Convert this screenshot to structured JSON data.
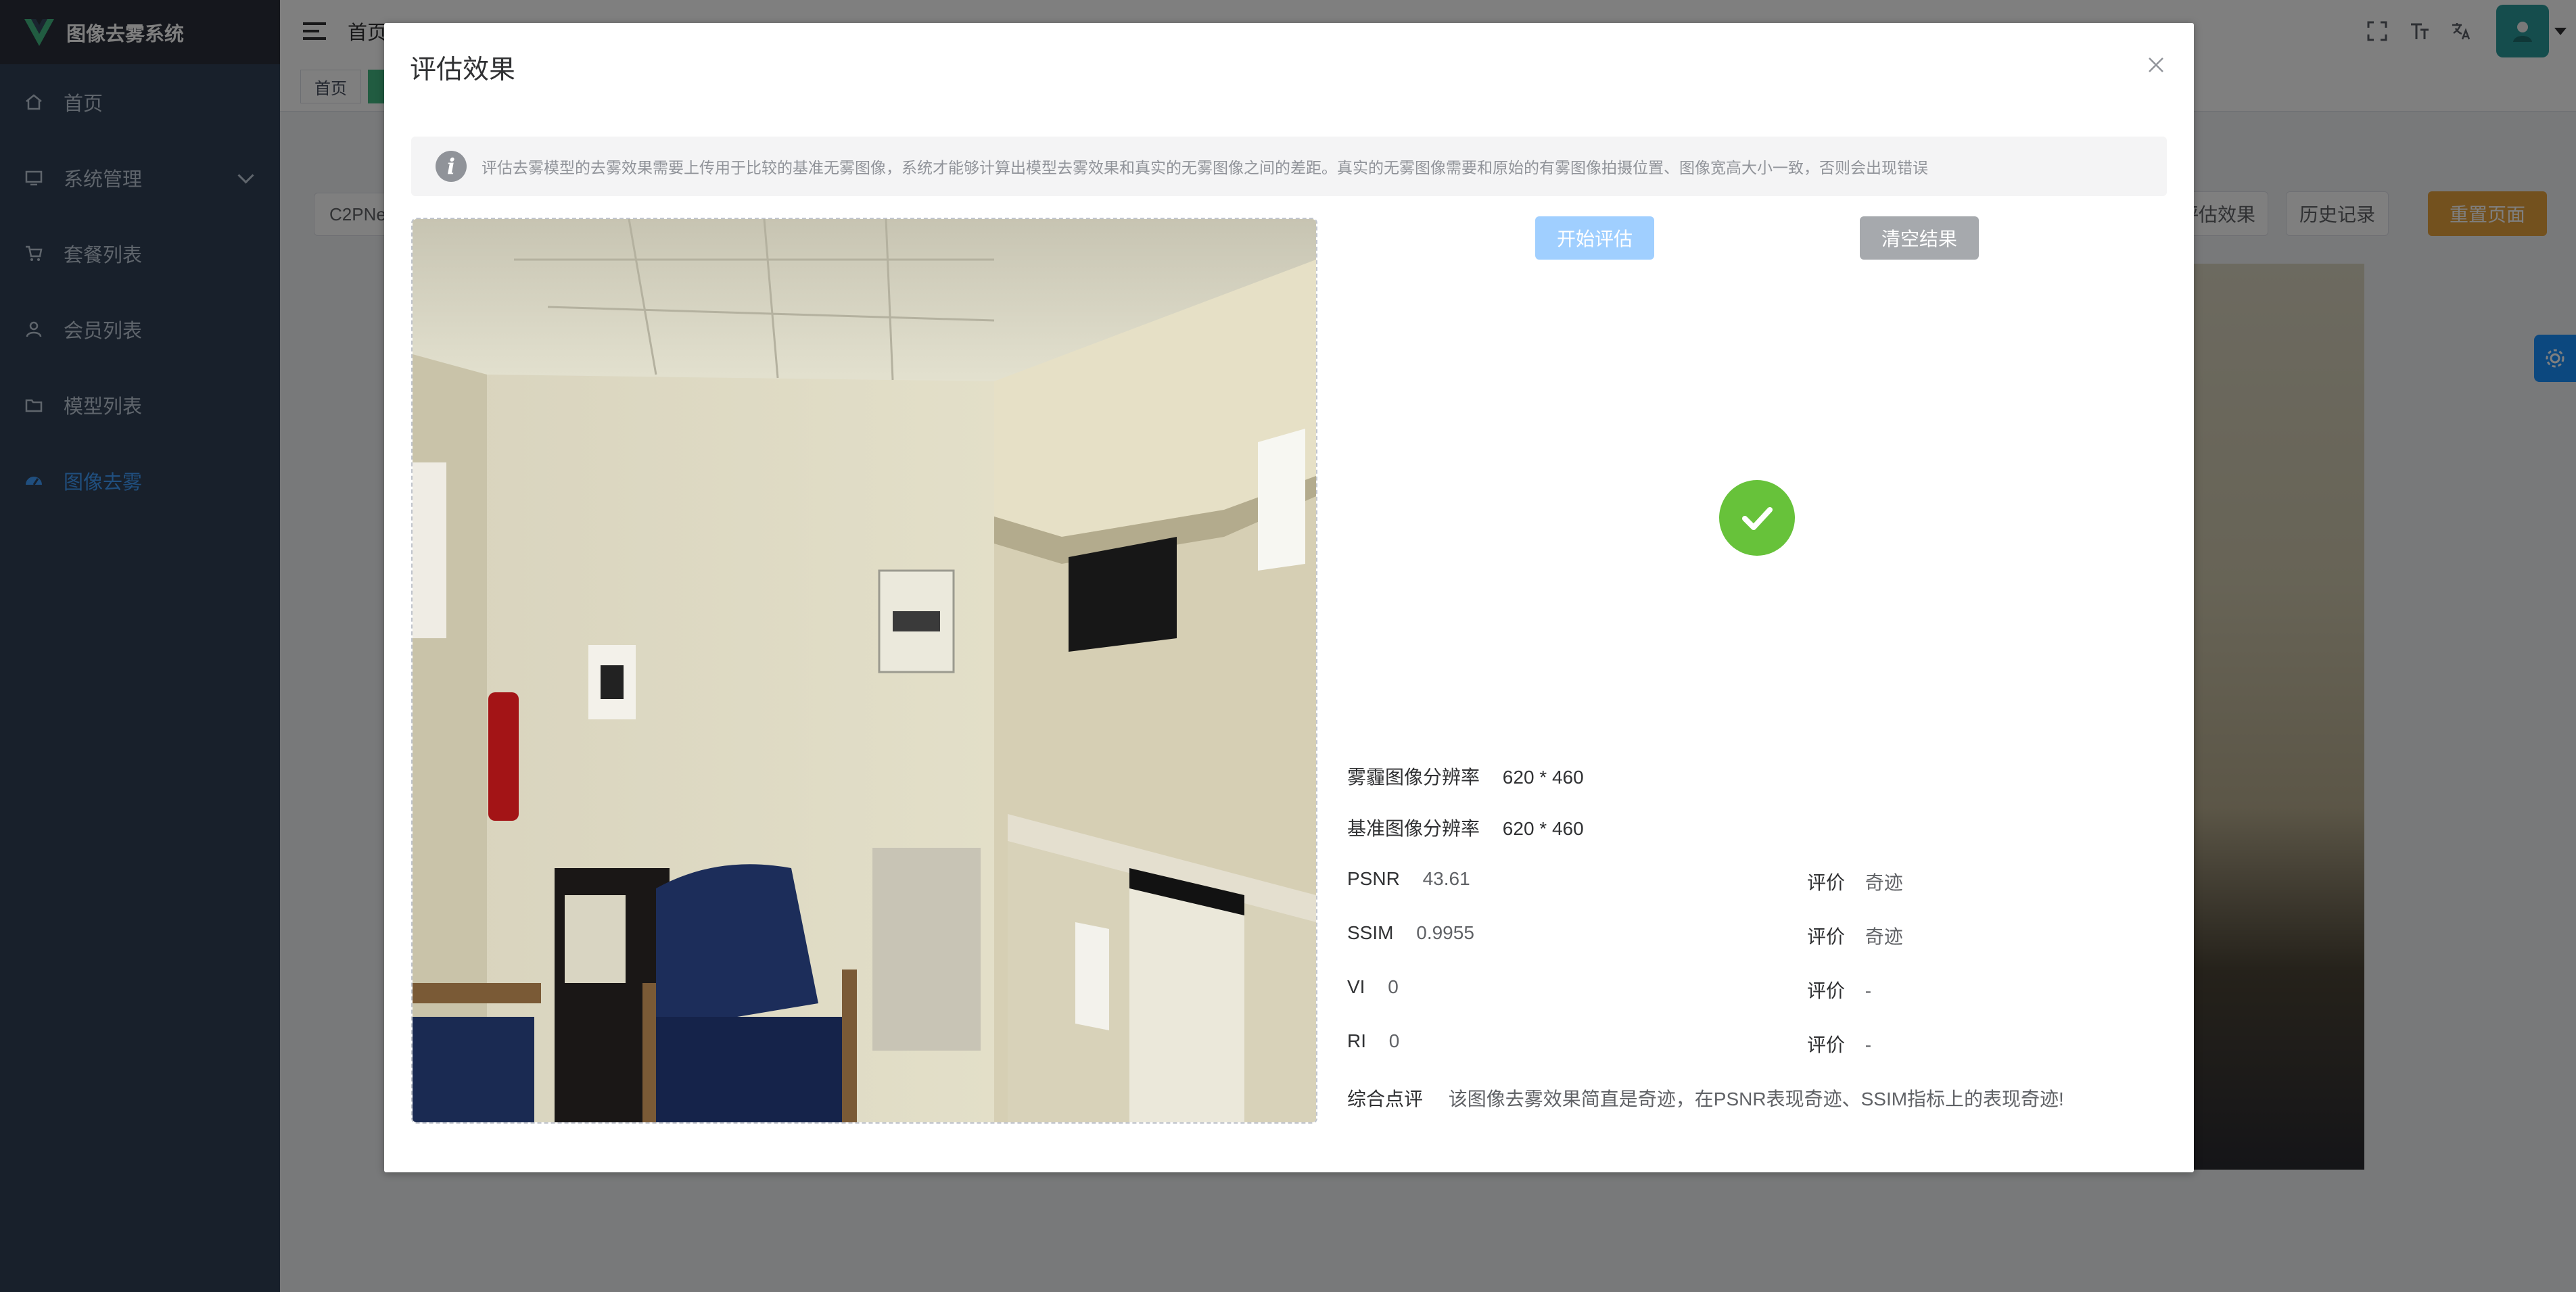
{
  "app": {
    "title": "图像去雾系统",
    "brand_color": "#42b983"
  },
  "sidebar": {
    "items": [
      {
        "label": "首页",
        "icon": "home-icon"
      },
      {
        "label": "系统管理",
        "icon": "monitor-icon",
        "expandable": true
      },
      {
        "label": "套餐列表",
        "icon": "cart-icon"
      },
      {
        "label": "会员列表",
        "icon": "user-icon"
      },
      {
        "label": "模型列表",
        "icon": "folder-icon"
      },
      {
        "label": "图像去雾",
        "icon": "dashboard-icon",
        "active": true
      }
    ],
    "active_color": "#409eff"
  },
  "topbar": {
    "breadcrumb_home": "首页"
  },
  "tags": {
    "home": "首页"
  },
  "page": {
    "search_value": "C2PNe",
    "buttons": {
      "evaluate": "评估效果",
      "history": "历史记录",
      "reset": "重置页面"
    }
  },
  "dialog": {
    "title": "评估效果",
    "notice": "评估去雾模型的去雾效果需要上传用于比较的基准无雾图像，系统才能够计算出模型去雾效果和真实的无雾图像之间的差距。真实的无雾图像需要和原始的有雾图像拍摄位置、图像宽高大小一致，否则会出现错误",
    "buttons": {
      "start": "开始评估",
      "clear": "清空结果"
    },
    "status": "success",
    "results": {
      "haze_res_label": "雾霾图像分辨率",
      "haze_res_value": "620 * 460",
      "base_res_label": "基准图像分辨率",
      "base_res_value": "620 * 460",
      "metrics": [
        {
          "name": "PSNR",
          "value": "43.61",
          "eval_label": "评价",
          "eval": "奇迹"
        },
        {
          "name": "SSIM",
          "value": "0.9955",
          "eval_label": "评价",
          "eval": "奇迹"
        },
        {
          "name": "VI",
          "value": "0",
          "eval_label": "评价",
          "eval": "-"
        },
        {
          "name": "RI",
          "value": "0",
          "eval_label": "评价",
          "eval": "-"
        }
      ],
      "summary_label": "综合点评",
      "summary": "该图像去雾效果简直是奇迹，在PSNR表现奇迹、SSIM指标上的表现奇迹!"
    }
  }
}
